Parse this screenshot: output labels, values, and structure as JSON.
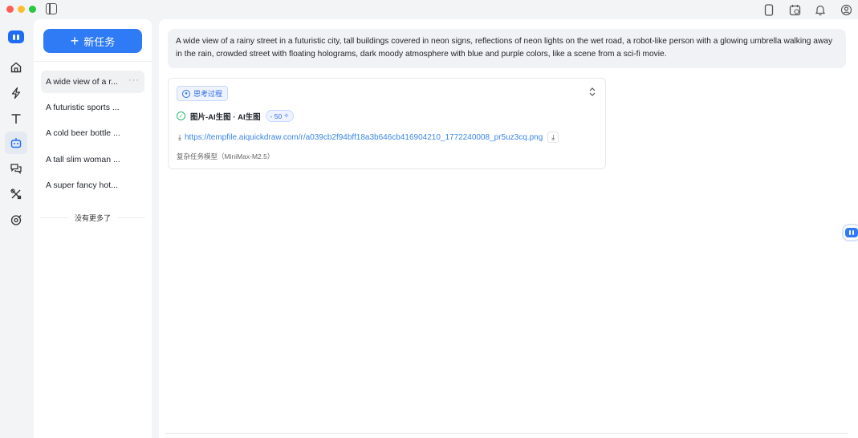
{
  "window": {
    "traffic_lights": [
      "close",
      "minimize",
      "zoom"
    ],
    "titlebar_icons": [
      "phone-icon",
      "calendar-icon",
      "bell-icon",
      "user-icon"
    ]
  },
  "rail": {
    "logo": "app-logo-icon",
    "items": [
      {
        "icon": "home-icon"
      },
      {
        "icon": "lightning-icon"
      },
      {
        "icon": "text-icon"
      },
      {
        "icon": "robot-icon",
        "active": true
      },
      {
        "icon": "chat-icon"
      },
      {
        "icon": "tools-icon"
      },
      {
        "icon": "target-icon"
      }
    ]
  },
  "tasks": {
    "new_task_label": "新任务",
    "items": [
      {
        "label": "A wide view of a r...",
        "active": true
      },
      {
        "label": "A futuristic sports ..."
      },
      {
        "label": "A cold beer bottle ..."
      },
      {
        "label": "A tall slim woman ..."
      },
      {
        "label": "A super fancy hot..."
      }
    ],
    "more_icon": "···",
    "no_more": "没有更多了"
  },
  "main": {
    "prompt": "A wide view of a rainy street in a futuristic city, tall buildings covered in neon signs, reflections of neon lights on the wet road, a robot-like person with a glowing umbrella walking away in the rain, crowded street with floating holograms, dark moody atmosphere with blue and purple colors, like a scene from a sci-fi movie.",
    "result": {
      "think_label": "思考过程",
      "tool_label": "图片-AI生图 · AI生图",
      "cost": "- 50",
      "link": "https://tempfile.aiquickdraw.com/r/a039cb2f94bff18a3b646cb416904210_1772240008_pr5uz3cq.png",
      "model_note": "复杂任务模型（MiniMax-M2.5）"
    }
  },
  "colors": {
    "accent": "#2f7bf6",
    "link": "#3a86e8",
    "success": "#2bb673"
  }
}
